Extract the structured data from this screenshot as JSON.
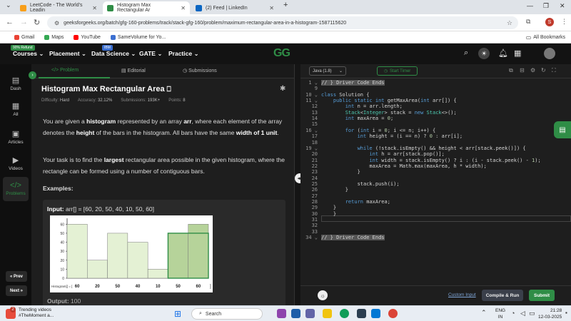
{
  "browser": {
    "tabs": [
      {
        "title": "LeetCode - The World's Leadin",
        "active": false,
        "color": "#f89f1b"
      },
      {
        "title": "Histogram Max Rectangular Ar",
        "active": true,
        "color": "#2f8d46"
      },
      {
        "title": "(2) Feed | LinkedIn",
        "active": false,
        "color": "#0a66c2"
      }
    ],
    "url": "geeksforgeeks.org/batch/gfg-160-problems/track/stack-gfg-160/problem/maximum-rectangular-area-in-a-histogram-1587115620",
    "profile_initial": "S",
    "bookmarks": [
      {
        "label": "Gmail",
        "color": "#ea4335"
      },
      {
        "label": "Maps",
        "color": "#34a853"
      },
      {
        "label": "YouTube",
        "color": "#ff0000"
      },
      {
        "label": "SameVolume for Yo...",
        "color": "#3b6fd1"
      }
    ],
    "all_bookmarks": "All Bookmarks"
  },
  "header": {
    "refund_badge": "90% Refund",
    "ibm_badge": "IBM",
    "menu": [
      "Courses",
      "Placement",
      "Data Science",
      "GATE",
      "Practice"
    ],
    "logo": "GG"
  },
  "rail": {
    "items": [
      {
        "label": "Dash",
        "glyph": "▤"
      },
      {
        "label": "All",
        "glyph": "▦"
      },
      {
        "label": "Articles",
        "glyph": "▣"
      },
      {
        "label": "Videos",
        "glyph": "▶"
      },
      {
        "label": "Problems",
        "glyph": "</>"
      }
    ],
    "prev": "« Prev",
    "next": "Next »"
  },
  "problem": {
    "tabs": [
      "Problem",
      "Editorial",
      "Submissions"
    ],
    "title": "Histogram Max Rectangular Area",
    "difficulty_label": "Difficulty:",
    "difficulty": "Hard",
    "accuracy_label": "Accuracy:",
    "accuracy": "32.12%",
    "submissions_label": "Submissions:",
    "submissions": "193K+",
    "points_label": "Points:",
    "points": "8",
    "para1": {
      "t1": "You are given a ",
      "b1": "histogram",
      "t2": " represented by an array ",
      "b2": "arr",
      "t3": ", where each element of the array denotes the ",
      "b3": "height",
      "t4": " of the bars in the histogram. All bars have the same ",
      "b4": "width of 1 unit",
      "t5": "."
    },
    "para2": {
      "t1": "Your task is to find the ",
      "b1": "largest",
      "t2": " rectangular area possible in the given histogram, where the rectangle can be formed using a number of contiguous bars."
    },
    "examples_label": "Examples:",
    "input_label": "Input:",
    "input_value": " arr[] = [60, 20, 50, 40, 10, 50, 60]",
    "output_label": "Output:",
    "output_value": " 100"
  },
  "chart_data": {
    "type": "bar",
    "categories": [
      "60",
      "20",
      "50",
      "40",
      "10",
      "50",
      "60"
    ],
    "values": [
      60,
      20,
      50,
      40,
      10,
      50,
      60
    ],
    "highlight": [
      5,
      6
    ],
    "highlight_height": 50,
    "yticks": [
      0,
      10,
      20,
      30,
      40,
      50,
      60
    ],
    "ylim": [
      0,
      65
    ],
    "xlabel": "Histogram[] = [",
    "xlabel_end": "]",
    "bar_color": "#e4f1d4",
    "highlight_color": "#b6d39a",
    "highlight_border": "#2f8d46"
  },
  "editor": {
    "language": "Java (1.8)",
    "timer": "Start Timer",
    "lines": [
      {
        "n": "1",
        "html": "<span class='hl'>// } Driver Code Ends</span>",
        "arrow": true
      },
      {
        "n": "9",
        "html": ""
      },
      {
        "n": "10",
        "html": "<span class='kw'>class</span> Solution {",
        "arrow": true
      },
      {
        "n": "11",
        "html": "    <span class='kw'>public static int</span> getMaxArea(<span class='kw'>int</span> arr[]) {",
        "arrow": true
      },
      {
        "n": "12",
        "html": "        <span class='kw'>int</span> n = arr.length;"
      },
      {
        "n": "13",
        "html": "        <span class='ty'>Stack</span>&lt;<span class='ty'>Integer</span>&gt; stack = <span class='kw'>new</span> <span class='ty'>Stack</span>&lt;&gt;();"
      },
      {
        "n": "14",
        "html": "        <span class='kw'>int</span> maxArea = <span class='num'>0</span>;"
      },
      {
        "n": "15",
        "html": ""
      },
      {
        "n": "16",
        "html": "        <span class='kw'>for</span> (<span class='kw'>int</span> i = <span class='num'>0</span>; i &lt;= n; i++) {",
        "arrow": true
      },
      {
        "n": "17",
        "html": "            <span class='kw'>int</span> height = (i == n) ? <span class='num'>0</span> : arr[i];"
      },
      {
        "n": "18",
        "html": ""
      },
      {
        "n": "19",
        "html": "            <span class='kw'>while</span> (!stack.isEmpty() &amp;&amp; height &lt; arr[stack.peek()]) {",
        "arrow": true
      },
      {
        "n": "20",
        "html": "                <span class='kw'>int</span> h = arr[stack.pop()];"
      },
      {
        "n": "21",
        "html": "                <span class='kw'>int</span> width = stack.isEmpty() ? i : (i - stack.peek() - <span class='num'>1</span>);"
      },
      {
        "n": "22",
        "html": "                maxArea = Math.max(maxArea, h * width);"
      },
      {
        "n": "23",
        "html": "            }"
      },
      {
        "n": "24",
        "html": ""
      },
      {
        "n": "25",
        "html": "            stack.push(i);"
      },
      {
        "n": "26",
        "html": "        }"
      },
      {
        "n": "27",
        "html": ""
      },
      {
        "n": "28",
        "html": "        <span class='kw'>return</span> maxArea;"
      },
      {
        "n": "29",
        "html": "    }"
      },
      {
        "n": "30",
        "html": "    }"
      },
      {
        "n": "31",
        "html": ""
      },
      {
        "n": "32",
        "html": ""
      },
      {
        "n": "33",
        "html": ""
      },
      {
        "n": "34",
        "html": "<span class='hl'>// } Driver Code Ends</span>",
        "arrow": true
      }
    ],
    "custom_input": "Custom Input",
    "compile_run": "Compile & Run",
    "submit": "Submit"
  },
  "taskbar": {
    "notif_count": "2",
    "trending_title": "Trending videos",
    "trending_sub": "#TheMoment a...",
    "search_placeholder": "Search",
    "lang_line1": "ENG",
    "lang_line2": "IN",
    "time": "21:28",
    "date": "12-03-2025"
  }
}
